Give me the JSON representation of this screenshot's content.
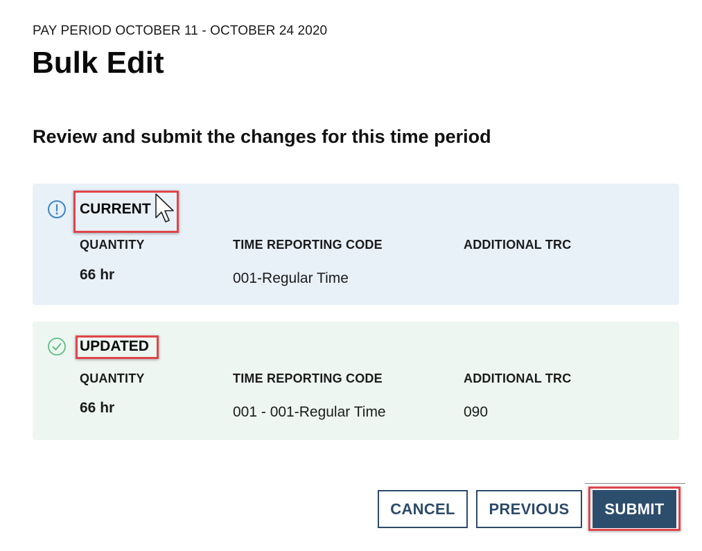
{
  "header": {
    "pay_period": "PAY PERIOD OCTOBER 11 - OCTOBER 24 2020",
    "title": "Bulk Edit",
    "subtitle": "Review and submit the changes for this time period"
  },
  "current": {
    "heading": "CURRENT",
    "icon": "info-circle-icon",
    "columns": [
      "QUANTITY",
      "TIME REPORTING CODE",
      "ADDITIONAL TRC"
    ],
    "quantity": "66 hr",
    "time_reporting_code": "001-Regular Time",
    "additional_trc": ""
  },
  "updated": {
    "heading": "UPDATED",
    "icon": "check-circle-icon",
    "columns": [
      "QUANTITY",
      "TIME REPORTING CODE",
      "ADDITIONAL TRC"
    ],
    "quantity": "66 hr",
    "time_reporting_code": "001 - 001-Regular Time",
    "additional_trc": "090"
  },
  "actions": {
    "cancel": "CANCEL",
    "previous": "PREVIOUS",
    "submit": "SUBMIT"
  },
  "colors": {
    "current_bg": "#e8f0f8",
    "updated_bg": "#eef6f1",
    "primary": "#2d4d6d",
    "highlight": "#e0444a"
  }
}
